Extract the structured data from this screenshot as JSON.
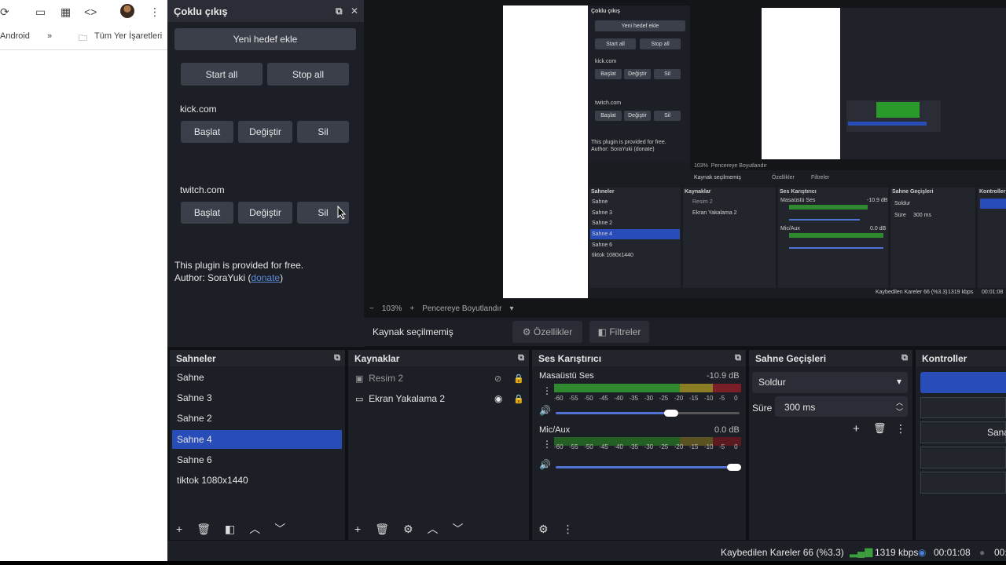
{
  "browser": {
    "bookmarks": [
      "Android",
      "»",
      "Tüm Yer İşaretleri"
    ]
  },
  "multi_output": {
    "title": "Çoklu çıkış",
    "add_target": "Yeni hedef ekle",
    "start_all": "Start all",
    "stop_all": "Stop all",
    "targets": [
      {
        "name": "kick.com",
        "start": "Başlat",
        "edit": "Değiştir",
        "delete": "Sil"
      },
      {
        "name": "twitch.com",
        "start": "Başlat",
        "edit": "Değiştir",
        "delete": "Sil"
      }
    ],
    "note_line1": "This plugin is provided for free.",
    "note_author": "Author: SoraYuki (",
    "note_link": "donate",
    "note_close": ")"
  },
  "preview": {
    "zoom": "103%",
    "fit_label": "Pencereye Boyutlandır",
    "nested": {
      "title": "Çoklu çıkış",
      "add": "Yeni hedef ekle",
      "start_all": "Start all",
      "stop_all": "Stop all",
      "t1": "kick.com",
      "t2": "twitch.com",
      "b_start": "Başlat",
      "b_edit": "Değiştir",
      "b_del": "Sil",
      "note1": "This plugin is provided for free.",
      "note2": "Author: SoraYuki (donate)",
      "zoom": "103%",
      "fit": "Pencereye Boyutlandır",
      "src_none": "Kaynak seçilmemiş",
      "props": "Özellikler",
      "filters": "Filtreler",
      "scenes_h": "Sahneler",
      "sources_h": "Kaynaklar",
      "mixer_h": "Ses Karıştırıcı",
      "trans_h": "Sahne Geçişleri",
      "ctrl_h": "Kontroller",
      "scenes": [
        "Sahne",
        "Sahne 3",
        "Sahne 2",
        "Sahne 4",
        "Sahne 6",
        "tiktok 1080x1440"
      ],
      "sources": [
        "Resim 2",
        "Ekran Yakalama 2"
      ],
      "a1": "Masaüstü Ses",
      "a1v": "-10.9 dB",
      "a2": "Mic/Aux",
      "a2v": "0.0 dB",
      "fade": "Soldur",
      "dur": "Süre",
      "durv": "300 ms",
      "status": "Kaybedilen Kareler 66 (%3.3)",
      "kbps": "1319 kbps",
      "time": "00:01:08"
    }
  },
  "source_bar": {
    "none_selected": "Kaynak seçilmemiş",
    "properties": "Özellikler",
    "filters": "Filtreler"
  },
  "scenes": {
    "title": "Sahneler",
    "items": [
      "Sahne",
      "Sahne 3",
      "Sahne 2",
      "Sahne 4",
      "Sahne 6",
      "tiktok 1080x1440"
    ],
    "selected_index": 3
  },
  "sources": {
    "title": "Kaynaklar",
    "items": [
      "Resim 2",
      "Ekran Yakalama 2"
    ]
  },
  "mixer": {
    "title": "Ses Karıştırıcı",
    "channels": [
      {
        "name": "Masaüstü Ses",
        "db": "-10.9 dB",
        "level": 0.82
      },
      {
        "name": "Mic/Aux",
        "db": "0.0 dB",
        "level": 1.0
      }
    ],
    "ticks": [
      "-60",
      "-55",
      "-50",
      "-45",
      "-40",
      "-35",
      "-30",
      "-25",
      "-20",
      "-15",
      "-10",
      "-5",
      "0"
    ]
  },
  "transitions": {
    "title": "Sahne Geçişleri",
    "transition": "Soldur",
    "duration_label": "Süre",
    "duration_value": "300 ms"
  },
  "controls": {
    "title": "Kontroller",
    "partial_label": "Sana"
  },
  "status": {
    "dropped": "Kaybedilen Kareler 66 (%3.3)",
    "bitrate": "1319 kbps",
    "time": "00:01:08",
    "time2": "00:"
  },
  "colors": {
    "accent": "#284cb8",
    "panel": "#1d1f26",
    "meter_green": "#3c9e3c",
    "meter_yellow": "#9a8a2a",
    "meter_red": "#9a2a2a"
  }
}
